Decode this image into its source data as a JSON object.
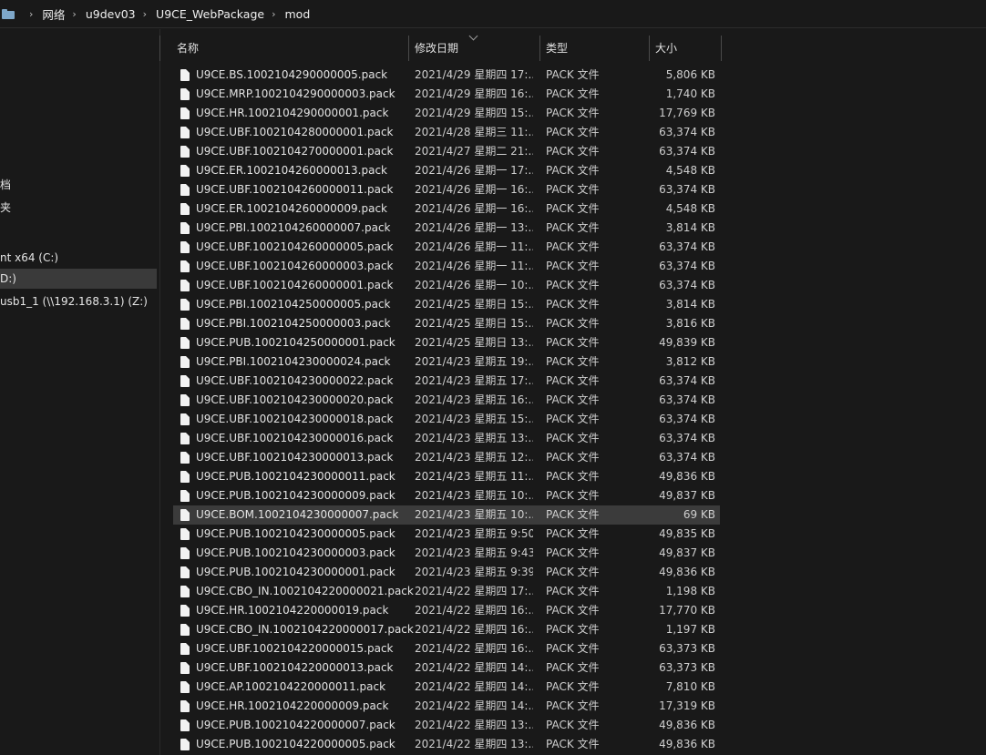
{
  "breadcrumb": {
    "icon": "folder-icon",
    "items": [
      "网络",
      "u9dev03",
      "U9CE_WebPackage",
      "mod"
    ],
    "separator": "›"
  },
  "sidebar": {
    "items": [
      {
        "label": "档",
        "selected": false
      },
      {
        "label": "夹",
        "selected": false
      },
      {
        "label": "nt x64 (C:)",
        "selected": false
      },
      {
        "label": "D:)",
        "selected": true
      },
      {
        "label": "usb1_1 (\\\\192.168.3.1) (Z:)",
        "selected": false
      }
    ]
  },
  "columns": {
    "name": "名称",
    "date": "修改日期",
    "type": "类型",
    "size": "大小"
  },
  "files": [
    {
      "name": "U9CE.BS.1002104290000005.pack",
      "date": "2021/4/29 星期四 17:...",
      "type": "PACK 文件",
      "size": "5,806 KB"
    },
    {
      "name": "U9CE.MRP.1002104290000003.pack",
      "date": "2021/4/29 星期四 16:...",
      "type": "PACK 文件",
      "size": "1,740 KB"
    },
    {
      "name": "U9CE.HR.1002104290000001.pack",
      "date": "2021/4/29 星期四 15:...",
      "type": "PACK 文件",
      "size": "17,769 KB"
    },
    {
      "name": "U9CE.UBF.1002104280000001.pack",
      "date": "2021/4/28 星期三 11:...",
      "type": "PACK 文件",
      "size": "63,374 KB"
    },
    {
      "name": "U9CE.UBF.1002104270000001.pack",
      "date": "2021/4/27 星期二 21:...",
      "type": "PACK 文件",
      "size": "63,374 KB"
    },
    {
      "name": "U9CE.ER.1002104260000013.pack",
      "date": "2021/4/26 星期一 17:...",
      "type": "PACK 文件",
      "size": "4,548 KB"
    },
    {
      "name": "U9CE.UBF.1002104260000011.pack",
      "date": "2021/4/26 星期一 16:...",
      "type": "PACK 文件",
      "size": "63,374 KB"
    },
    {
      "name": "U9CE.ER.1002104260000009.pack",
      "date": "2021/4/26 星期一 16:...",
      "type": "PACK 文件",
      "size": "4,548 KB"
    },
    {
      "name": "U9CE.PBI.1002104260000007.pack",
      "date": "2021/4/26 星期一 13:...",
      "type": "PACK 文件",
      "size": "3,814 KB"
    },
    {
      "name": "U9CE.UBF.1002104260000005.pack",
      "date": "2021/4/26 星期一 11:...",
      "type": "PACK 文件",
      "size": "63,374 KB"
    },
    {
      "name": "U9CE.UBF.1002104260000003.pack",
      "date": "2021/4/26 星期一 11:...",
      "type": "PACK 文件",
      "size": "63,374 KB"
    },
    {
      "name": "U9CE.UBF.1002104260000001.pack",
      "date": "2021/4/26 星期一 10:...",
      "type": "PACK 文件",
      "size": "63,374 KB"
    },
    {
      "name": "U9CE.PBI.1002104250000005.pack",
      "date": "2021/4/25 星期日 15:...",
      "type": "PACK 文件",
      "size": "3,814 KB"
    },
    {
      "name": "U9CE.PBI.1002104250000003.pack",
      "date": "2021/4/25 星期日 15:...",
      "type": "PACK 文件",
      "size": "3,816 KB"
    },
    {
      "name": "U9CE.PUB.1002104250000001.pack",
      "date": "2021/4/25 星期日 13:...",
      "type": "PACK 文件",
      "size": "49,839 KB"
    },
    {
      "name": "U9CE.PBI.1002104230000024.pack",
      "date": "2021/4/23 星期五 19:...",
      "type": "PACK 文件",
      "size": "3,812 KB"
    },
    {
      "name": "U9CE.UBF.1002104230000022.pack",
      "date": "2021/4/23 星期五 17:...",
      "type": "PACK 文件",
      "size": "63,374 KB"
    },
    {
      "name": "U9CE.UBF.1002104230000020.pack",
      "date": "2021/4/23 星期五 16:...",
      "type": "PACK 文件",
      "size": "63,374 KB"
    },
    {
      "name": "U9CE.UBF.1002104230000018.pack",
      "date": "2021/4/23 星期五 15:...",
      "type": "PACK 文件",
      "size": "63,374 KB"
    },
    {
      "name": "U9CE.UBF.1002104230000016.pack",
      "date": "2021/4/23 星期五 13:...",
      "type": "PACK 文件",
      "size": "63,374 KB"
    },
    {
      "name": "U9CE.UBF.1002104230000013.pack",
      "date": "2021/4/23 星期五 12:...",
      "type": "PACK 文件",
      "size": "63,374 KB"
    },
    {
      "name": "U9CE.PUB.1002104230000011.pack",
      "date": "2021/4/23 星期五 11:...",
      "type": "PACK 文件",
      "size": "49,836 KB"
    },
    {
      "name": "U9CE.PUB.1002104230000009.pack",
      "date": "2021/4/23 星期五 10:...",
      "type": "PACK 文件",
      "size": "49,837 KB"
    },
    {
      "name": "U9CE.BOM.1002104230000007.pack",
      "date": "2021/4/23 星期五 10:...",
      "type": "PACK 文件",
      "size": "69 KB",
      "selected": true
    },
    {
      "name": "U9CE.PUB.1002104230000005.pack",
      "date": "2021/4/23 星期五 9:50",
      "type": "PACK 文件",
      "size": "49,835 KB"
    },
    {
      "name": "U9CE.PUB.1002104230000003.pack",
      "date": "2021/4/23 星期五 9:43",
      "type": "PACK 文件",
      "size": "49,837 KB"
    },
    {
      "name": "U9CE.PUB.1002104230000001.pack",
      "date": "2021/4/23 星期五 9:39",
      "type": "PACK 文件",
      "size": "49,836 KB"
    },
    {
      "name": "U9CE.CBO_IN.1002104220000021.pack",
      "date": "2021/4/22 星期四 17:...",
      "type": "PACK 文件",
      "size": "1,198 KB"
    },
    {
      "name": "U9CE.HR.1002104220000019.pack",
      "date": "2021/4/22 星期四 16:...",
      "type": "PACK 文件",
      "size": "17,770 KB"
    },
    {
      "name": "U9CE.CBO_IN.1002104220000017.pack",
      "date": "2021/4/22 星期四 16:...",
      "type": "PACK 文件",
      "size": "1,197 KB"
    },
    {
      "name": "U9CE.UBF.1002104220000015.pack",
      "date": "2021/4/22 星期四 16:...",
      "type": "PACK 文件",
      "size": "63,373 KB"
    },
    {
      "name": "U9CE.UBF.1002104220000013.pack",
      "date": "2021/4/22 星期四 14:...",
      "type": "PACK 文件",
      "size": "63,373 KB"
    },
    {
      "name": "U9CE.AP.1002104220000011.pack",
      "date": "2021/4/22 星期四 14:...",
      "type": "PACK 文件",
      "size": "7,810 KB"
    },
    {
      "name": "U9CE.HR.1002104220000009.pack",
      "date": "2021/4/22 星期四 14:...",
      "type": "PACK 文件",
      "size": "17,319 KB"
    },
    {
      "name": "U9CE.PUB.1002104220000007.pack",
      "date": "2021/4/22 星期四 13:...",
      "type": "PACK 文件",
      "size": "49,836 KB"
    },
    {
      "name": "U9CE.PUB.1002104220000005.pack",
      "date": "2021/4/22 星期四 13:...",
      "type": "PACK 文件",
      "size": "49,836 KB"
    }
  ]
}
